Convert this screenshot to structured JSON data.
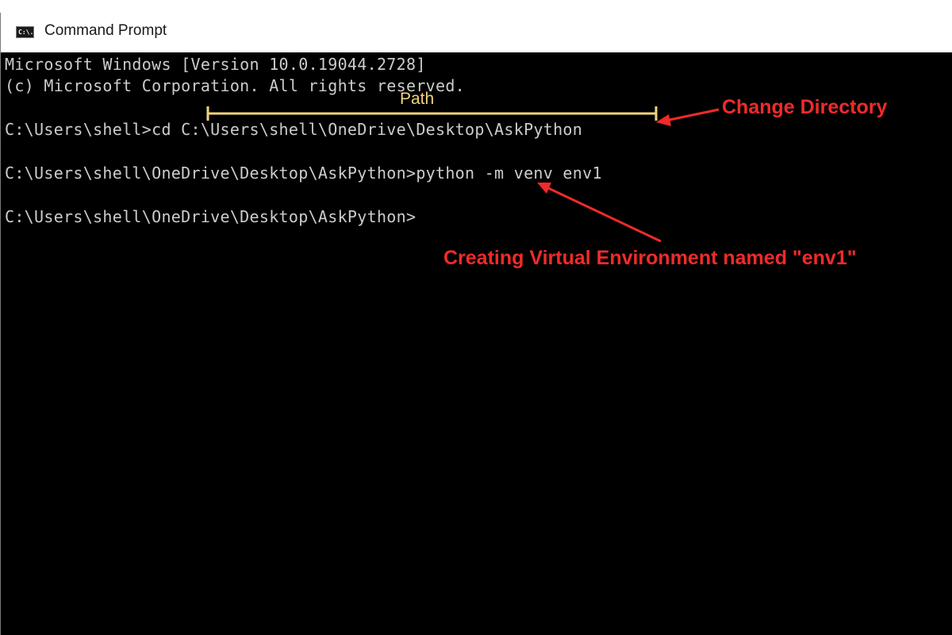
{
  "window": {
    "title": "Command Prompt",
    "icon": "cmd-icon",
    "icon_text": "C:\\."
  },
  "console": {
    "lines": [
      "Microsoft Windows [Version 10.0.19044.2728]",
      "(c) Microsoft Corporation. All rights reserved.",
      "C:\\Users\\shell>cd C:\\Users\\shell\\OneDrive\\Desktop\\AskPython",
      "C:\\Users\\shell\\OneDrive\\Desktop\\AskPython>python -m venv env1",
      "C:\\Users\\shell\\OneDrive\\Desktop\\AskPython>"
    ]
  },
  "annotations": {
    "path_label": "Path",
    "change_directory": "Change Directory",
    "creating_env": "Creating Virtual Environment named \"env1\"",
    "colors": {
      "path_bracket": "#f3d37a",
      "arrow": "#ef2b2b"
    }
  }
}
